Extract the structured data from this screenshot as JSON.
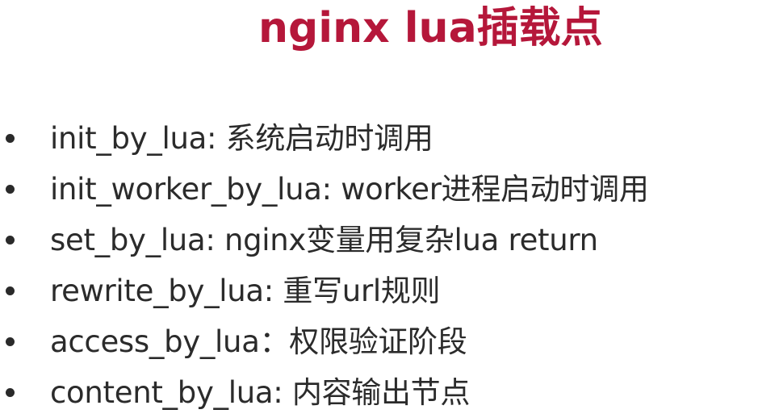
{
  "slide": {
    "title": "nginx lua插载点",
    "title_color": "#b5173a",
    "text_color": "#2b2b2b",
    "bullets": [
      {
        "icon": "bullet-dot-icon",
        "text": "init_by_lua:  系统启动时调用"
      },
      {
        "icon": "bullet-dot-icon",
        "text": "init_worker_by_lua: worker进程启动时调用"
      },
      {
        "icon": "bullet-dot-icon",
        "text": "set_by_lua: nginx变量用复杂lua return"
      },
      {
        "icon": "bullet-dot-icon",
        "text": "rewrite_by_lua: 重写url规则"
      },
      {
        "icon": "bullet-dot-icon",
        "text": "access_by_lua：权限验证阶段"
      },
      {
        "icon": "bullet-dot-icon",
        "text": "content_by_lua: 内容输出节点"
      }
    ]
  }
}
